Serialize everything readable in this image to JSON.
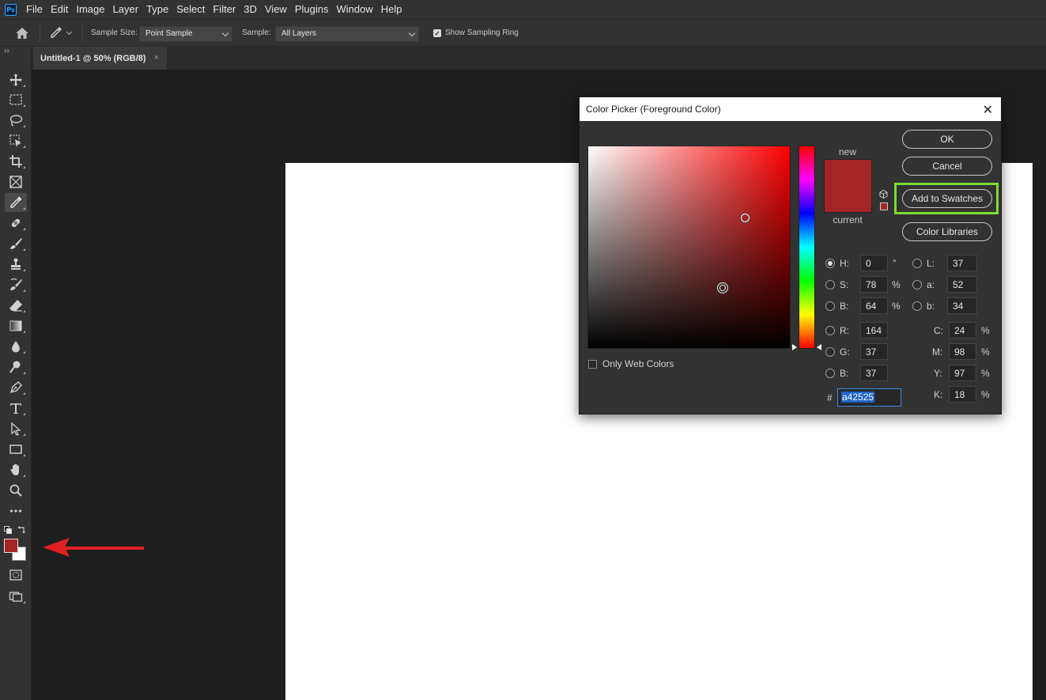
{
  "app": {
    "logo_text": "Ps"
  },
  "menu": [
    "File",
    "Edit",
    "Image",
    "Layer",
    "Type",
    "Select",
    "Filter",
    "3D",
    "View",
    "Plugins",
    "Window",
    "Help"
  ],
  "options_bar": {
    "sample_size_label": "Sample Size:",
    "sample_size_value": "Point Sample",
    "sample_label": "Sample:",
    "sample_value": "All Layers",
    "show_ring_label": "Show Sampling Ring",
    "show_ring_checked": true
  },
  "panel_toggle": "››",
  "document_tab": {
    "title": "Untitled-1 @ 50% (RGB/8)",
    "close": "×"
  },
  "toolbar": {
    "tools": [
      "move-tool",
      "marquee-tool",
      "lasso-tool",
      "object-select-tool",
      "crop-tool",
      "frame-tool",
      "eyedropper-tool",
      "healing-brush-tool",
      "brush-tool",
      "clone-stamp-tool",
      "history-brush-tool",
      "eraser-tool",
      "gradient-tool",
      "blur-tool",
      "dodge-tool",
      "pen-tool",
      "type-tool",
      "path-select-tool",
      "rectangle-tool",
      "hand-tool",
      "zoom-tool",
      "more-tools",
      "quick-mask",
      "screen-mode"
    ],
    "active_tool": "eyedropper-tool",
    "foreground_color": "#a42525",
    "background_color": "#ffffff"
  },
  "color_picker": {
    "title": "Color Picker (Foreground Color)",
    "close": "✕",
    "label_new": "new",
    "label_current": "current",
    "new_color": "#a42525",
    "current_color": "#a42525",
    "buttons": {
      "ok": "OK",
      "cancel": "Cancel",
      "add_to_swatches": "Add to Swatches",
      "color_libraries": "Color Libraries"
    },
    "only_web_colors_label": "Only Web Colors",
    "only_web_colors_checked": false,
    "hsb": {
      "h_label": "H:",
      "h": "0",
      "h_unit": "°",
      "s_label": "S:",
      "s": "78",
      "s_unit": "%",
      "b_label": "B:",
      "b": "64",
      "b_unit": "%"
    },
    "lab": {
      "l_label": "L:",
      "l": "37",
      "a_label": "a:",
      "a": "52",
      "b_label": "b:",
      "b": "34"
    },
    "rgb": {
      "r_label": "R:",
      "r": "164",
      "g_label": "G:",
      "g": "37",
      "b_label": "B:",
      "b": "37"
    },
    "cmyk": {
      "c_label": "C:",
      "c": "24",
      "m_label": "M:",
      "m": "98",
      "y_label": "Y:",
      "y": "97",
      "k_label": "K:",
      "k": "18",
      "unit": "%"
    },
    "hex_label": "#",
    "hex": "a42525",
    "selected_radio": "H"
  },
  "annotations": {
    "arrow_color": "#e02020",
    "highlight_color": "#7cdc2e"
  }
}
